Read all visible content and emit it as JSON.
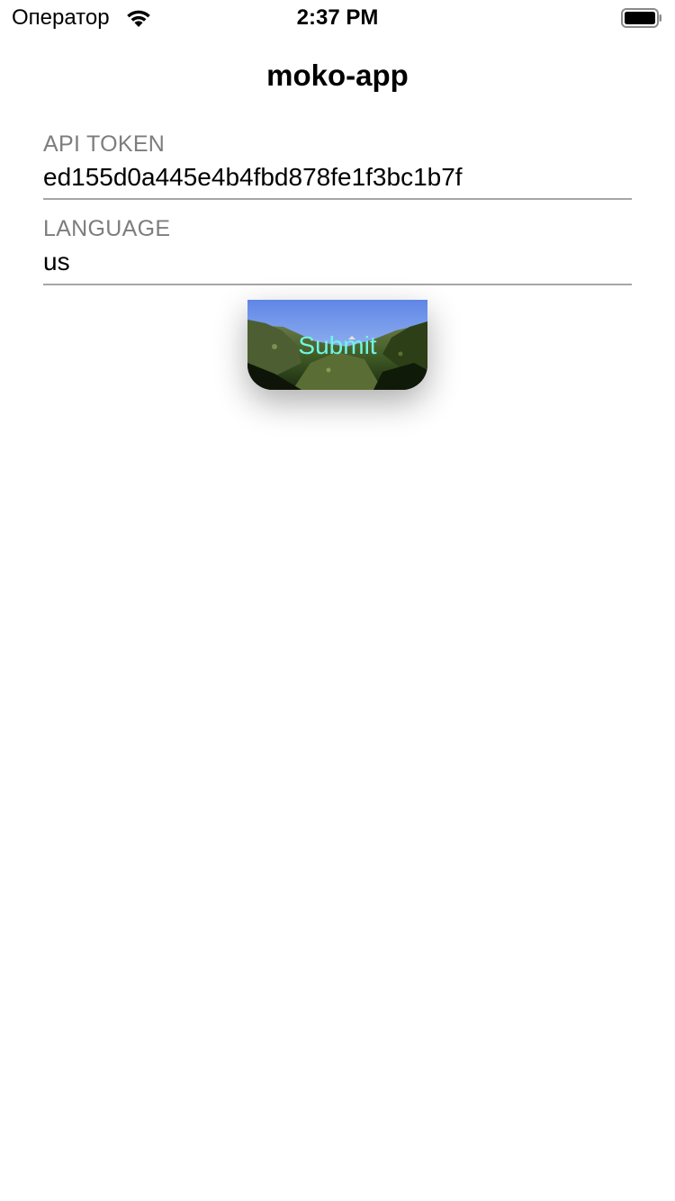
{
  "status_bar": {
    "carrier": "Оператор",
    "time": "2:37 PM",
    "wifi_icon": "wifi-icon",
    "battery_icon": "battery-icon"
  },
  "nav": {
    "title": "moko-app"
  },
  "form": {
    "api_token": {
      "label": "API TOKEN",
      "value": "ed155d0a445e4b4fbd878fe1f3bc1b7f"
    },
    "language": {
      "label": "LANGUAGE",
      "value": "us"
    }
  },
  "submit": {
    "label": "Submit",
    "label_color": "#6ff5e3"
  }
}
